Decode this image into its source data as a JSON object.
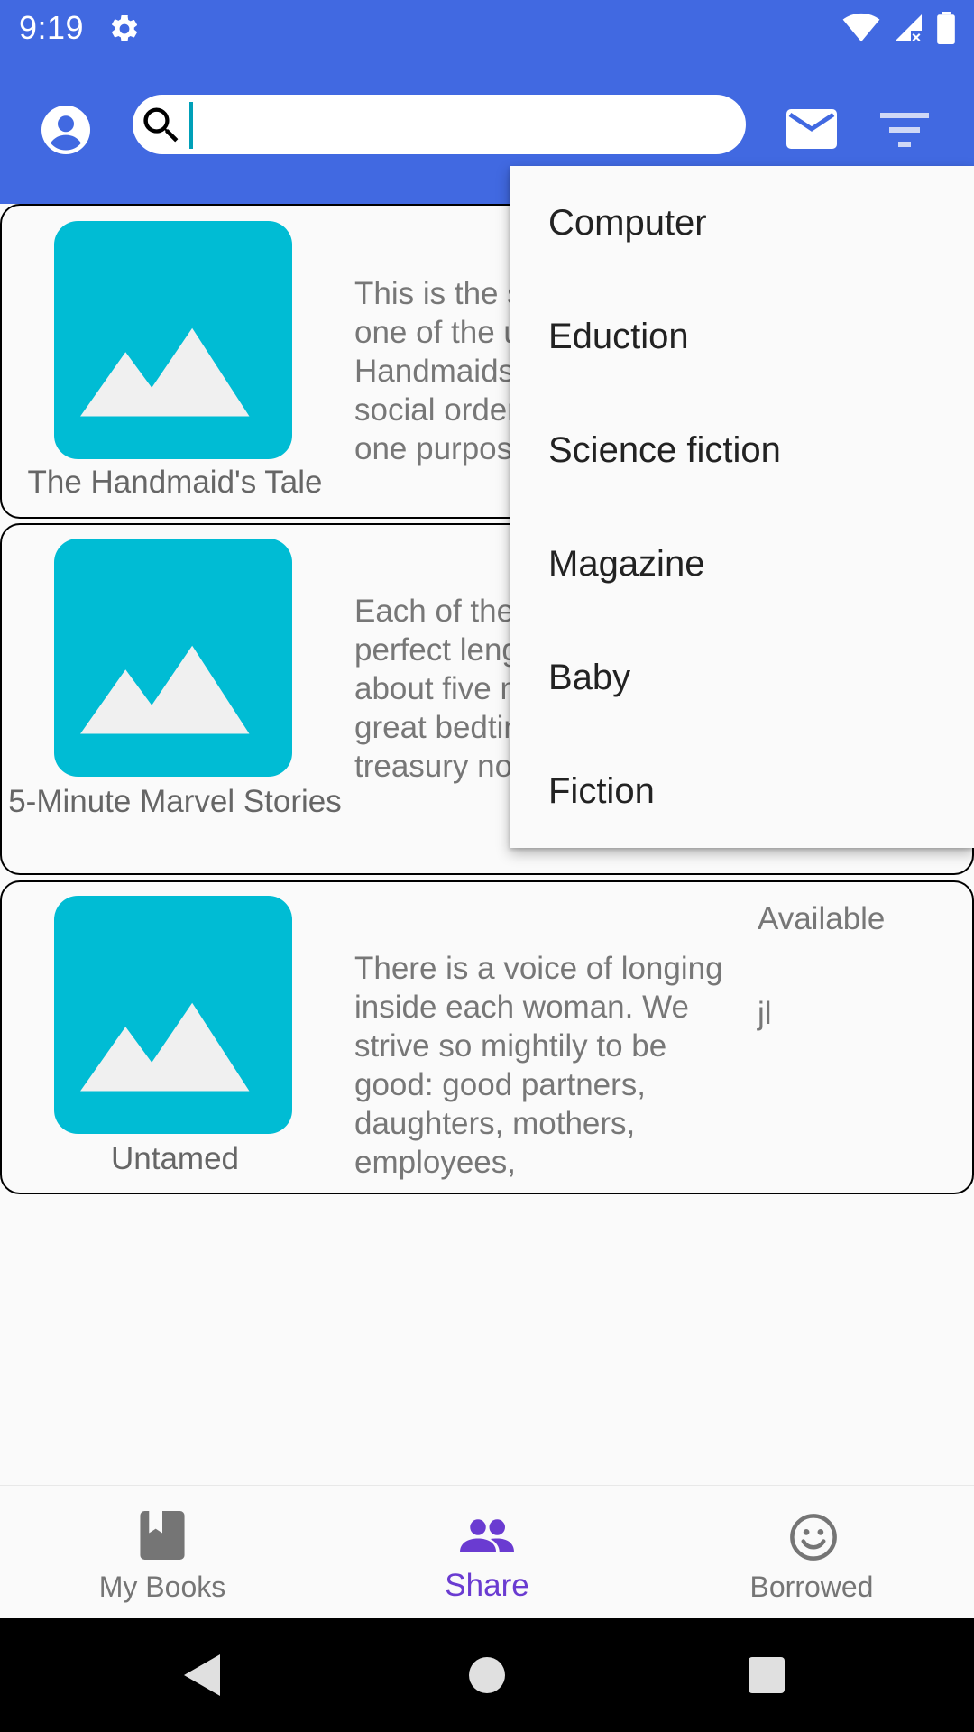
{
  "status_bar": {
    "time": "9:19",
    "icons": [
      "settings-icon",
      "wifi-icon",
      "signal-icon",
      "battery-icon"
    ]
  },
  "app_bar": {
    "search_value": "",
    "search_placeholder": "",
    "icons": [
      "account-icon",
      "search-icon",
      "mail-icon",
      "filter-icon"
    ]
  },
  "books": [
    {
      "title": "The Handmaid's Tale",
      "description": "This is the story of Offred, one of the unfortunate Handmaids under the new social order who have only one purpose",
      "status": "",
      "owner": ""
    },
    {
      "title": "5-Minute Marvel Stories",
      "description": "Each of the stories is the perfect length for reading in about five minutes, making great bedtime reads. This treasury not only",
      "status": "",
      "owner": ""
    },
    {
      "title": "Untamed",
      "description": "There is a voice of longing inside each woman. We strive so mightily to be good: good partners, daughters, mothers, employees,",
      "status": "Available",
      "owner": "jl"
    }
  ],
  "filter_menu": {
    "items": [
      "Computer",
      "Eduction",
      "Science fiction",
      "Magazine",
      "Baby",
      "Fiction"
    ]
  },
  "bottom_nav": {
    "items": [
      {
        "label": "My Books",
        "icon": "book-icon",
        "active": false
      },
      {
        "label": "Share",
        "icon": "people-icon",
        "active": true
      },
      {
        "label": "Borrowed",
        "icon": "smiley-icon",
        "active": false
      }
    ]
  },
  "colors": {
    "primary": "#4169e1",
    "accent": "#6a3bd1",
    "thumbnail": "#00bcd4"
  }
}
